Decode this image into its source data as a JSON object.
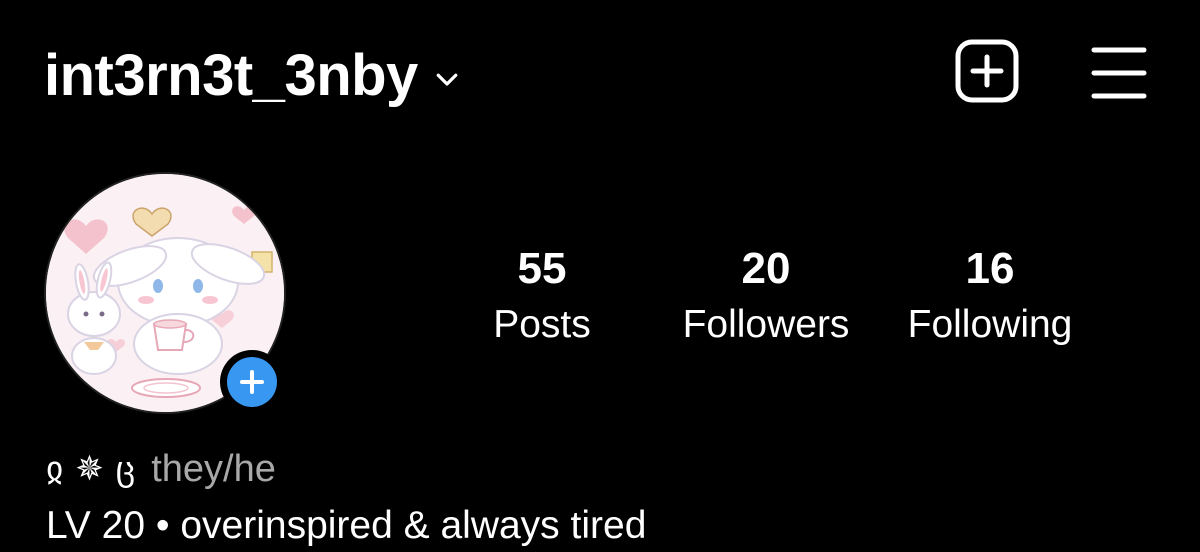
{
  "header": {
    "username": "int3rn3t_3nby",
    "account_switcher_icon": "chevron-down-icon",
    "create_icon": "plus-square-icon",
    "menu_icon": "hamburger-menu-icon"
  },
  "profile": {
    "avatar_icon": "profile-picture",
    "add_story_icon": "plus-icon",
    "add_story_color": "#3897f0"
  },
  "stats": {
    "posts": {
      "count": "55",
      "label": "Posts"
    },
    "followers": {
      "count": "20",
      "label": "Followers"
    },
    "following": {
      "count": "16",
      "label": "Following"
    }
  },
  "bio": {
    "deco_left": "ჲ",
    "deco_mid": "✵",
    "deco_right": "ც",
    "pronouns": "they/he",
    "line2": "LV 20 • overinspired & always tired"
  },
  "colors": {
    "background": "#000000",
    "text": "#ffffff",
    "secondary_text": "#a8a8a8",
    "accent": "#3897f0"
  }
}
